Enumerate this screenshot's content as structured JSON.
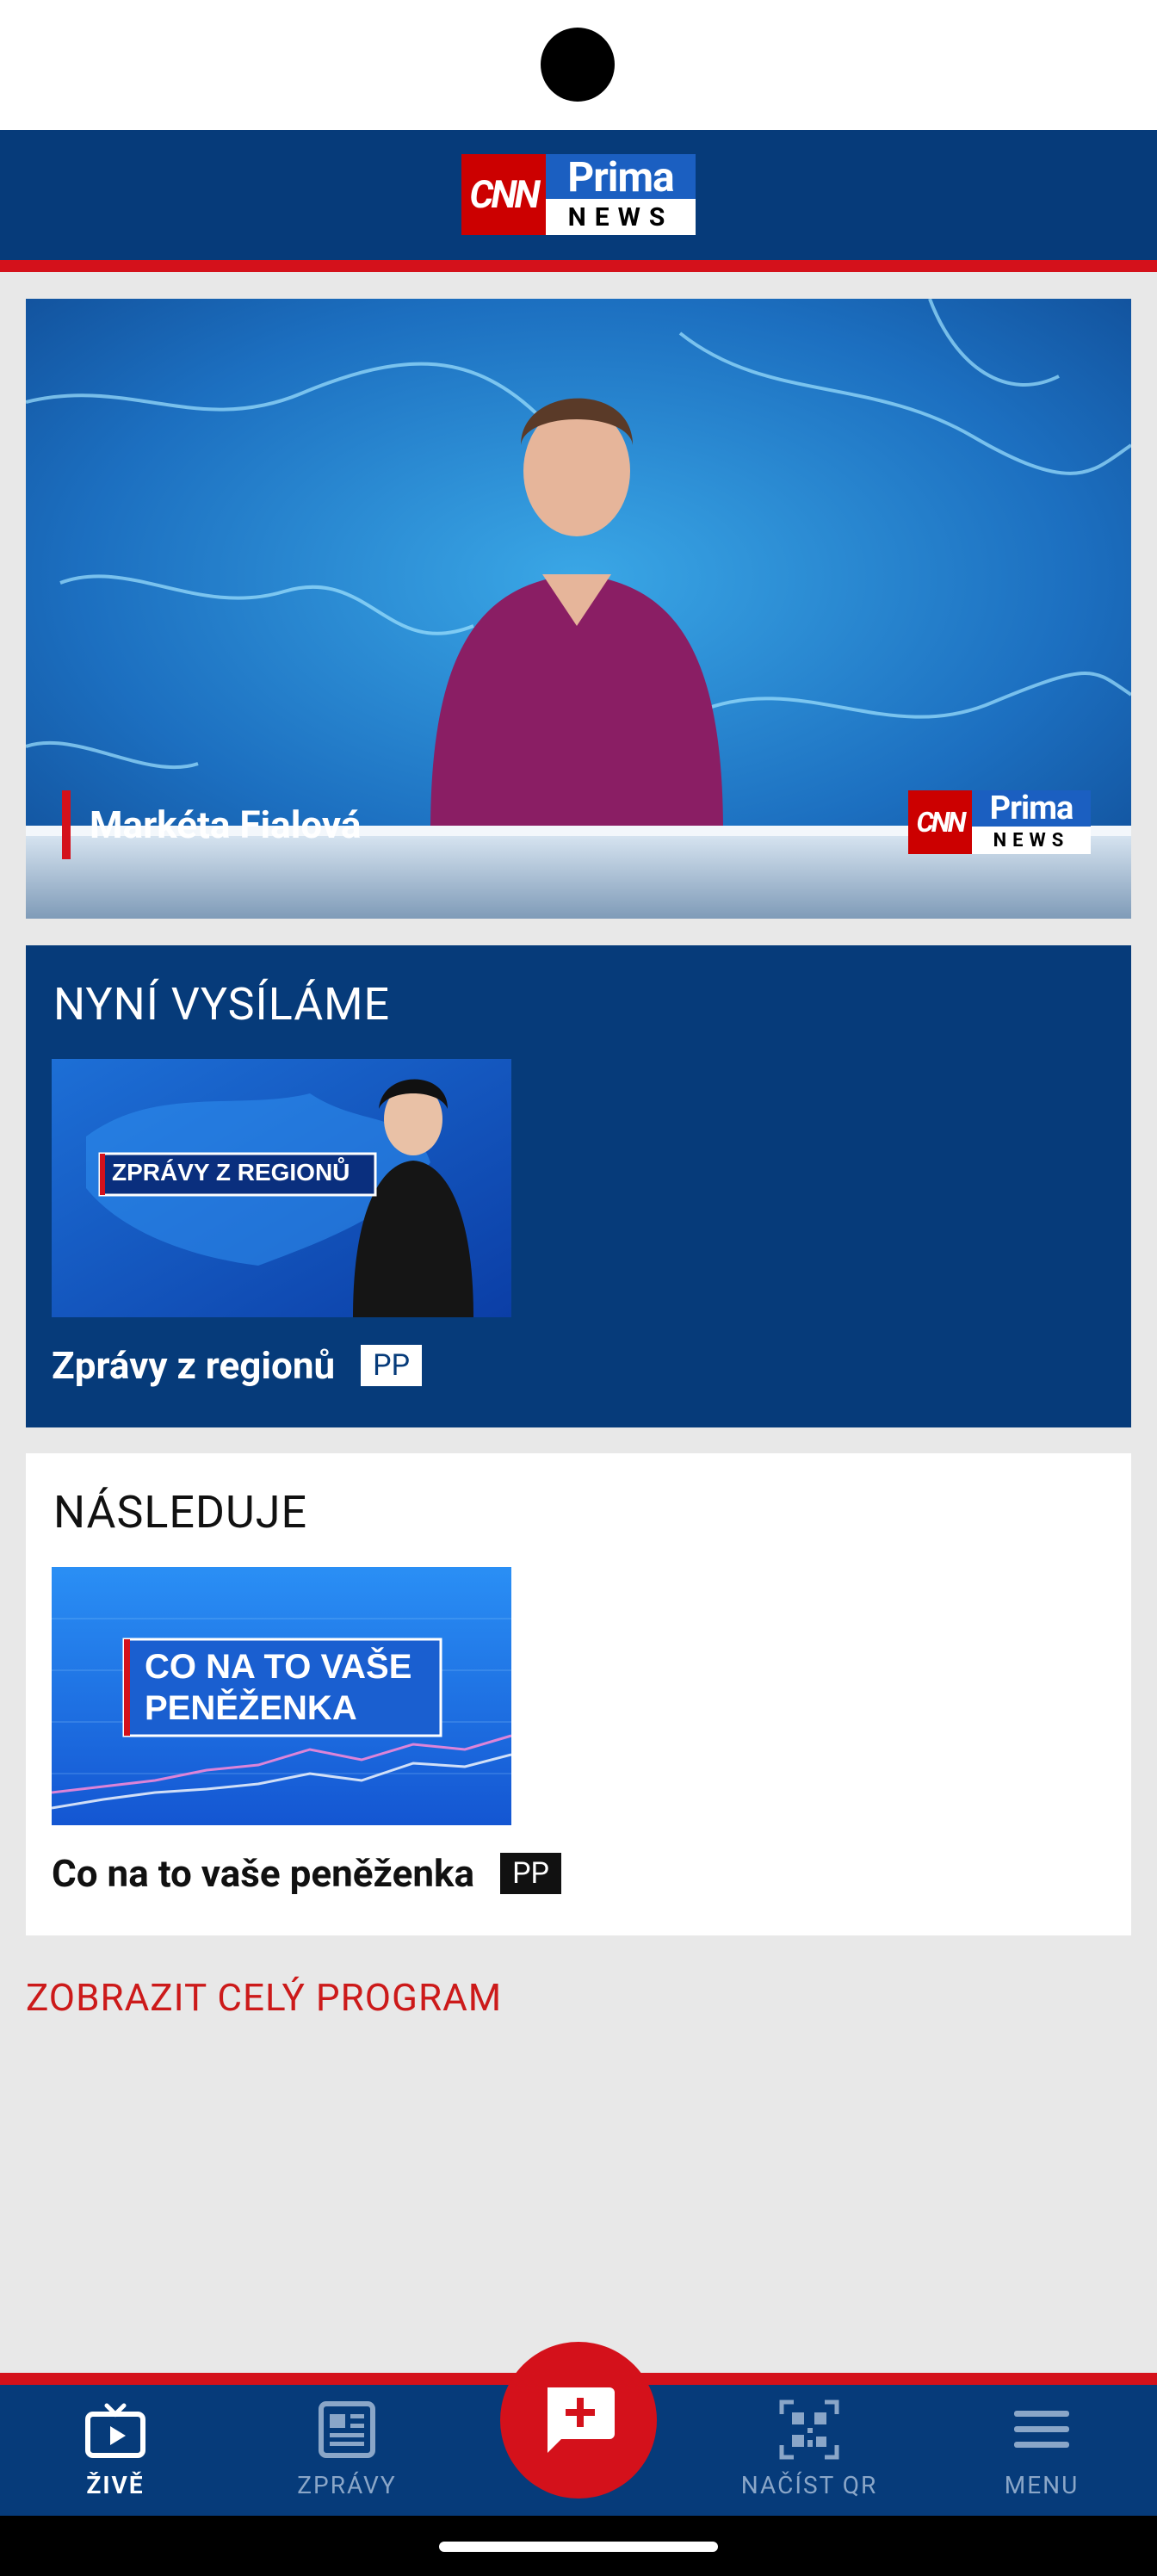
{
  "header": {
    "logo": {
      "cnn": "CNN",
      "prima": "Prima",
      "news": "NEWS"
    }
  },
  "live_player": {
    "anchor_name": "Markéta Fialová",
    "logo": {
      "cnn": "CNN",
      "prima": "Prima",
      "news": "NEWS"
    }
  },
  "now_playing": {
    "heading": "NYNÍ VYSÍLÁME",
    "thumbnail_text": "ZPRÁVY Z REGIONŮ",
    "title": "Zprávy z regionů",
    "badge": "PP"
  },
  "up_next": {
    "heading": "NÁSLEDUJE",
    "thumbnail_text_line1": "CO NA TO VAŠE",
    "thumbnail_text_line2": "PENĚŽENKA",
    "title": "Co na to vaše peněženka",
    "badge": "PP"
  },
  "program_link": "ZOBRAZIT CELÝ PROGRAM",
  "bottom_nav": {
    "items": [
      {
        "label": "ŽIVĚ",
        "icon": "tv-icon",
        "active": true
      },
      {
        "label": "ZPRÁVY",
        "icon": "newspaper-icon",
        "active": false
      },
      {
        "label": "NAČÍST QR",
        "icon": "qr-code-icon",
        "active": false
      },
      {
        "label": "MENU",
        "icon": "hamburger-menu-icon",
        "active": false
      }
    ],
    "fab_icon": "add-message-icon"
  },
  "colors": {
    "brand_blue": "#063b7a",
    "brand_red": "#d4111b",
    "link_red": "#cc1a1a",
    "background": "#e8e8e8"
  }
}
